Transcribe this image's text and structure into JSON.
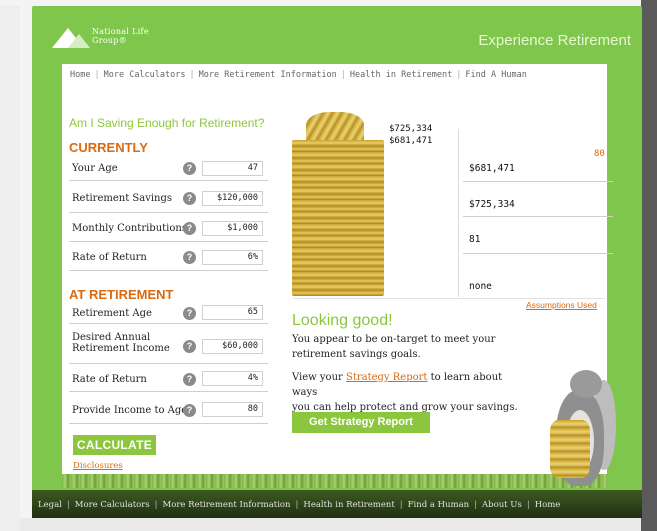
{
  "header": {
    "logo_line1": "National Life",
    "logo_line2": "Group®",
    "title": "Experience Retirement"
  },
  "nav": [
    "Home",
    "More Calculators",
    "More Retirement Information",
    "Health in Retirement",
    "Find A Human"
  ],
  "section_title": "Am I Saving Enough for Retirement?",
  "currently": {
    "heading": "CURRENTLY",
    "rows": [
      {
        "label": "Your Age",
        "value": "47"
      },
      {
        "label": "Retirement Savings",
        "value": "$120,000"
      },
      {
        "label": "Monthly Contributions",
        "value": "$1,000"
      },
      {
        "label": "Rate of Return",
        "value": "6%"
      }
    ]
  },
  "at_retirement": {
    "heading": "AT RETIREMENT",
    "rows": [
      {
        "label": "Retirement Age",
        "value": "65"
      },
      {
        "label": "Desired Annual Retirement Income",
        "label1": "Desired Annual",
        "label2": "Retirement Income",
        "value": "$60,000"
      },
      {
        "label": "Rate of Return",
        "value": "4%"
      },
      {
        "label": "Provide Income to Age",
        "value": "80"
      }
    ]
  },
  "help_glyph": "?",
  "calculate_label": "CALCULATE",
  "disclosures_label": "Disclosures",
  "coin_labels": {
    "top": "$725,334",
    "bottom": "$681,471"
  },
  "results": {
    "age_label": "80",
    "values": [
      "$681,471",
      "$725,334",
      "81",
      "none"
    ]
  },
  "assumptions_label": "Assumptions Used",
  "looking_good": {
    "title": "Looking good!",
    "line1": "You appear to be on-target to meet your",
    "line2": "retirement savings goals.",
    "line3_pre": "View your ",
    "line3_link": "Strategy Report",
    "line3_post": " to learn about ways",
    "line4": "you can help protect and grow your savings."
  },
  "strategy_button": "Get Strategy Report",
  "footer": [
    "Legal",
    "More Calculators",
    "More Retirement Information",
    "Health in Retirement",
    "Find a Human",
    "About Us",
    "Home"
  ],
  "colors": {
    "accent_green": "#8cc63f",
    "accent_orange": "#d96a11",
    "frame_green": "#7fc64d"
  }
}
